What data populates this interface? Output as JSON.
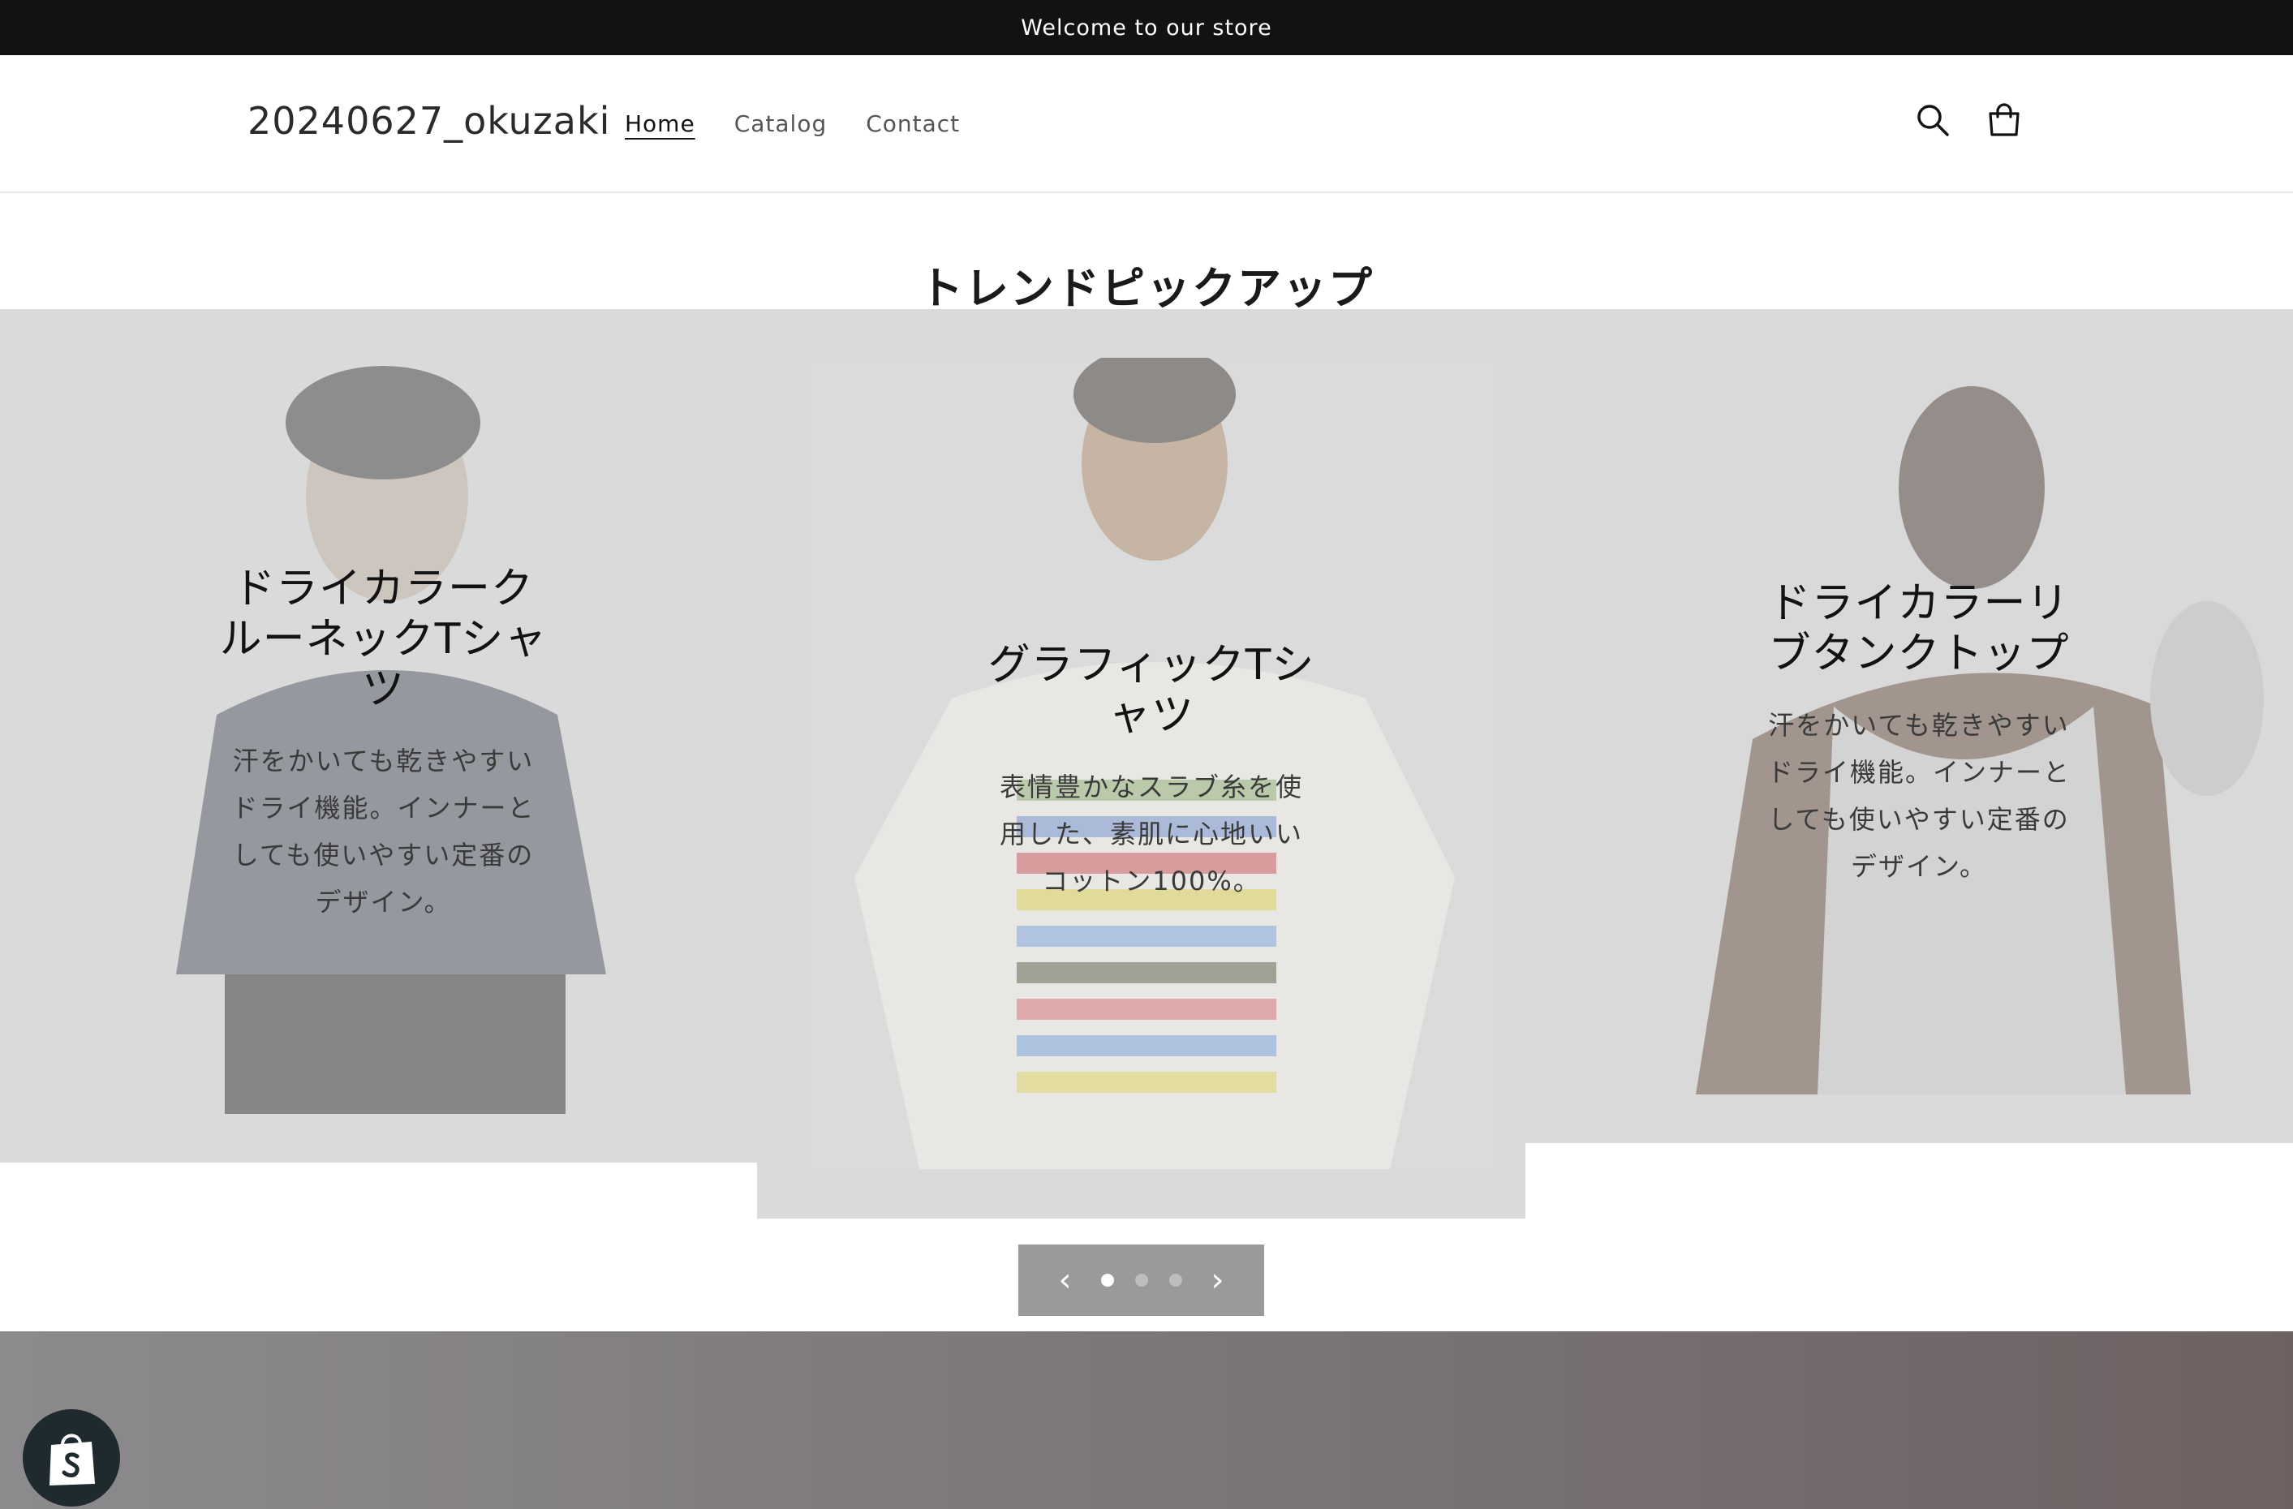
{
  "announcement": {
    "text": "Welcome to our store"
  },
  "header": {
    "logo": "20240627_okuzaki",
    "nav": [
      {
        "label": "Home",
        "active": true
      },
      {
        "label": "Catalog",
        "active": false
      },
      {
        "label": "Contact",
        "active": false
      }
    ],
    "icons": [
      "search-icon",
      "cart-icon"
    ]
  },
  "section": {
    "title": "トレンドピックアップ"
  },
  "slides": [
    {
      "title": "ドライカラーク\nルーネックTシャ\nツ",
      "description": "汗をかいても乾きやすい\nドライ機能。インナーと\nしても使いやすい定番の\nデザイン。"
    },
    {
      "title": "グラフィックTシ\nャツ",
      "description": "表情豊かなスラブ糸を使\n用した、素肌に心地いい\nコットン100%。"
    },
    {
      "title": "ドライカラーリ\nブタンクトップ",
      "description": "汗をかいても乾きやすい\nドライ機能。インナーと\nしても使いやすい定番の\nデザイン。"
    }
  ],
  "slider_controls": {
    "prev_icon": "chevron-left-icon",
    "next_icon": "chevron-right-icon",
    "total_slides": 3,
    "active_slide": 1
  },
  "shopify_badge": {
    "icon": "shopify-bag-icon"
  },
  "colors": {
    "announcement_bg": "#121212",
    "slide_bg": "#dadada",
    "controls_bg": "#9a9a9a"
  }
}
